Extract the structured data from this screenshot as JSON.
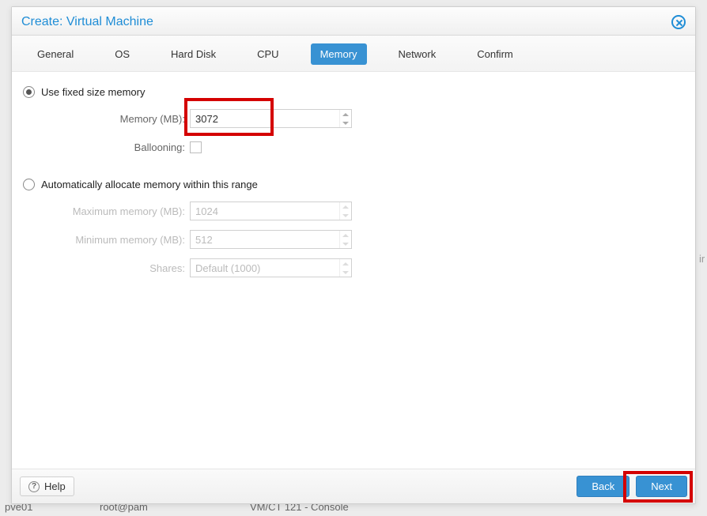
{
  "dialog": {
    "title": "Create: Virtual Machine"
  },
  "tabs": [
    "General",
    "OS",
    "Hard Disk",
    "CPU",
    "Memory",
    "Network",
    "Confirm"
  ],
  "active_tab_index": 4,
  "option_fixed": {
    "radio_label": "Use fixed size memory",
    "checked": true,
    "memory_label": "Memory (MB):",
    "memory_value": "3072",
    "ballooning_label": "Ballooning:",
    "ballooning_checked": false
  },
  "option_auto": {
    "radio_label": "Automatically allocate memory within this range",
    "checked": false,
    "max_label": "Maximum memory (MB):",
    "max_value": "1024",
    "min_label": "Minimum memory (MB):",
    "min_value": "512",
    "shares_label": "Shares:",
    "shares_value": "Default (1000)"
  },
  "footer": {
    "help": "Help",
    "back": "Back",
    "next": "Next"
  },
  "highlights": {
    "memory_input": true,
    "next_button": true
  },
  "background": {
    "host": "pve01",
    "user": "root@pam",
    "panel": "VM/CT 121 - Console"
  }
}
